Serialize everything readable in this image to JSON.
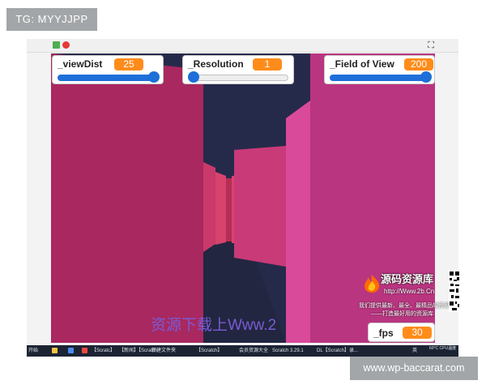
{
  "corner_tags": {
    "top_left": "TG: MYYJJPP",
    "bottom_right": "www.wp-baccarat.com"
  },
  "window": {
    "fullscreen_glyph": "⛶"
  },
  "monitors": {
    "view_dist": {
      "label": "_viewDist",
      "value": "25",
      "slider_level": 1.0
    },
    "resolution": {
      "label": "_Resolution",
      "value": "1",
      "slider_level": 0.0
    },
    "field_of_view": {
      "label": "_Field of View",
      "value": "200",
      "slider_level": 1.0
    },
    "fps": {
      "label": "_fps",
      "value": "30"
    }
  },
  "overlay_text": "资源下载上Www.2",
  "watermark": {
    "title": "源码资源库",
    "url": "http://Www.2b.Cn",
    "line1": "我们提供最新、最全、最精品的资源",
    "line2": "——打造最好用的资源库"
  },
  "taskbar": {
    "items": [
      "开始",
      "【Scratc】",
      "【新闻】【Scratch",
      "新建文件夹",
      "【Scratch】",
      "会员资源大全",
      "Scratch 3.29.1",
      "DL【Scratch】录..."
    ],
    "time": "英",
    "status": "60°C CPU温度"
  },
  "colors": {
    "stage_bg": "#262a4a",
    "wall_left": "#a8285f",
    "wall_right": "#b93580",
    "accent_orange": "#ff8c1a",
    "slider_blue": "#1e6fd9"
  }
}
